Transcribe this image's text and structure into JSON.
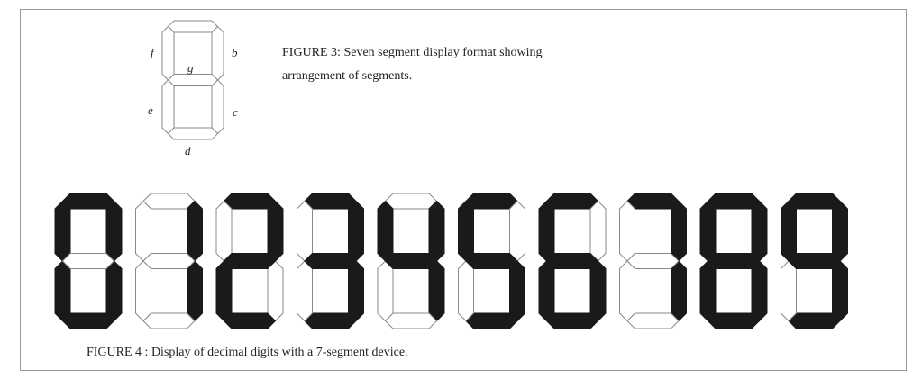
{
  "figure3": {
    "segment_labels": {
      "a": "",
      "b": "b",
      "c": "c",
      "d": "d",
      "e": "e",
      "f": "f",
      "g": "g"
    },
    "caption_line1": "FIGURE 3: Seven segment display format showing",
    "caption_line2": "arrangement of segments."
  },
  "figure4": {
    "caption": "FIGURE 4 : Display of decimal digits with a 7-segment device.",
    "digits": [
      {
        "digit": 0,
        "segments": "abcdef"
      },
      {
        "digit": 1,
        "segments": "bc"
      },
      {
        "digit": 2,
        "segments": "abged"
      },
      {
        "digit": 3,
        "segments": "abgcd"
      },
      {
        "digit": 4,
        "segments": "fgbc"
      },
      {
        "digit": 5,
        "segments": "afgcd"
      },
      {
        "digit": 6,
        "segments": "afgedc"
      },
      {
        "digit": 7,
        "segments": "abc"
      },
      {
        "digit": 8,
        "segments": "abcdefg"
      },
      {
        "digit": 9,
        "segments": "abcdfg"
      }
    ]
  },
  "colors": {
    "lit": "#1a1a1a",
    "unlit_fill": "#ffffff",
    "outline": "#8a8a8a"
  }
}
